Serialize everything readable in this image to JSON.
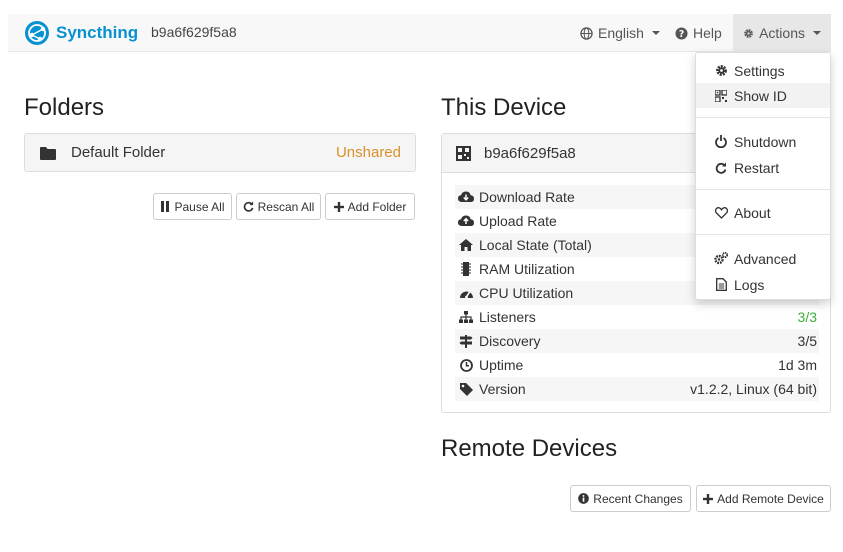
{
  "navbar": {
    "brand": "Syncthing",
    "device_name": "b9a6f629f5a8",
    "language": "English",
    "help": "Help",
    "actions": "Actions"
  },
  "folders": {
    "heading": "Folders",
    "items": [
      {
        "name": "Default Folder",
        "status": "Unshared"
      }
    ],
    "buttons": {
      "pause_all": "Pause All",
      "rescan_all": "Rescan All",
      "add_folder": "Add Folder"
    }
  },
  "this_device": {
    "heading": "This Device",
    "name": "b9a6f629f5a8",
    "rows": [
      {
        "label": "Download Rate",
        "value": "",
        "icon": "cloud-download-icon"
      },
      {
        "label": "Upload Rate",
        "value": "",
        "icon": "cloud-upload-icon"
      },
      {
        "label": "Local State (Total)",
        "value": "",
        "icon": "home-icon"
      },
      {
        "label": "RAM Utilization",
        "value": "",
        "icon": "memory-chip-icon"
      },
      {
        "label": "CPU Utilization",
        "value": "",
        "icon": "tachometer-icon"
      },
      {
        "label": "Listeners",
        "value": "3/3",
        "icon": "sitemap-icon"
      },
      {
        "label": "Discovery",
        "value": "3/5",
        "icon": "signpost-icon"
      },
      {
        "label": "Uptime",
        "value": "1d 3m",
        "icon": "clock-icon"
      },
      {
        "label": "Version",
        "value": "v1.2.2, Linux (64 bit)",
        "icon": "tag-icon"
      }
    ]
  },
  "remote_devices": {
    "heading": "Remote Devices",
    "buttons": {
      "recent_changes": "Recent Changes",
      "add_remote_device": "Add Remote Device"
    }
  },
  "actions_menu": {
    "items": [
      "Settings",
      "Show ID",
      "Shutdown",
      "Restart",
      "About",
      "Advanced",
      "Logs"
    ]
  },
  "colors": {
    "brand": "#0891d1",
    "unshared": "#d9902a",
    "ok": "#3cae3c"
  }
}
